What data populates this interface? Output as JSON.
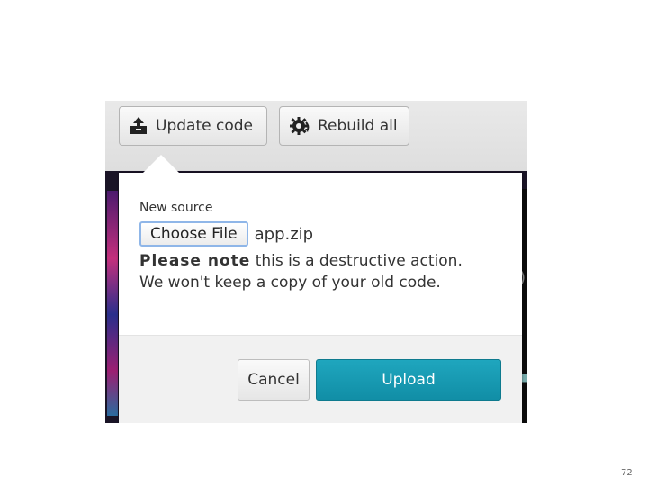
{
  "toolbar": {
    "update_label": "Update code",
    "update_icon": "upload-box-icon",
    "rebuild_label": "Rebuild all",
    "rebuild_icon": "gear-refresh-icon"
  },
  "popover": {
    "new_source_label": "New source",
    "choose_file_label": "Choose File",
    "file_name": "app.zip",
    "warning_bold": "Please note",
    "warning_line1_rest": " this is a destructive action.",
    "warning_line2": "We won't keep a copy of your old code.",
    "cancel_label": "Cancel",
    "upload_label": "Upload"
  },
  "colors": {
    "upload_button": "#1a9db5",
    "toolbar_bg": "#e4e4e4",
    "footer_bg": "#f1f1f1"
  },
  "page_number": "72"
}
